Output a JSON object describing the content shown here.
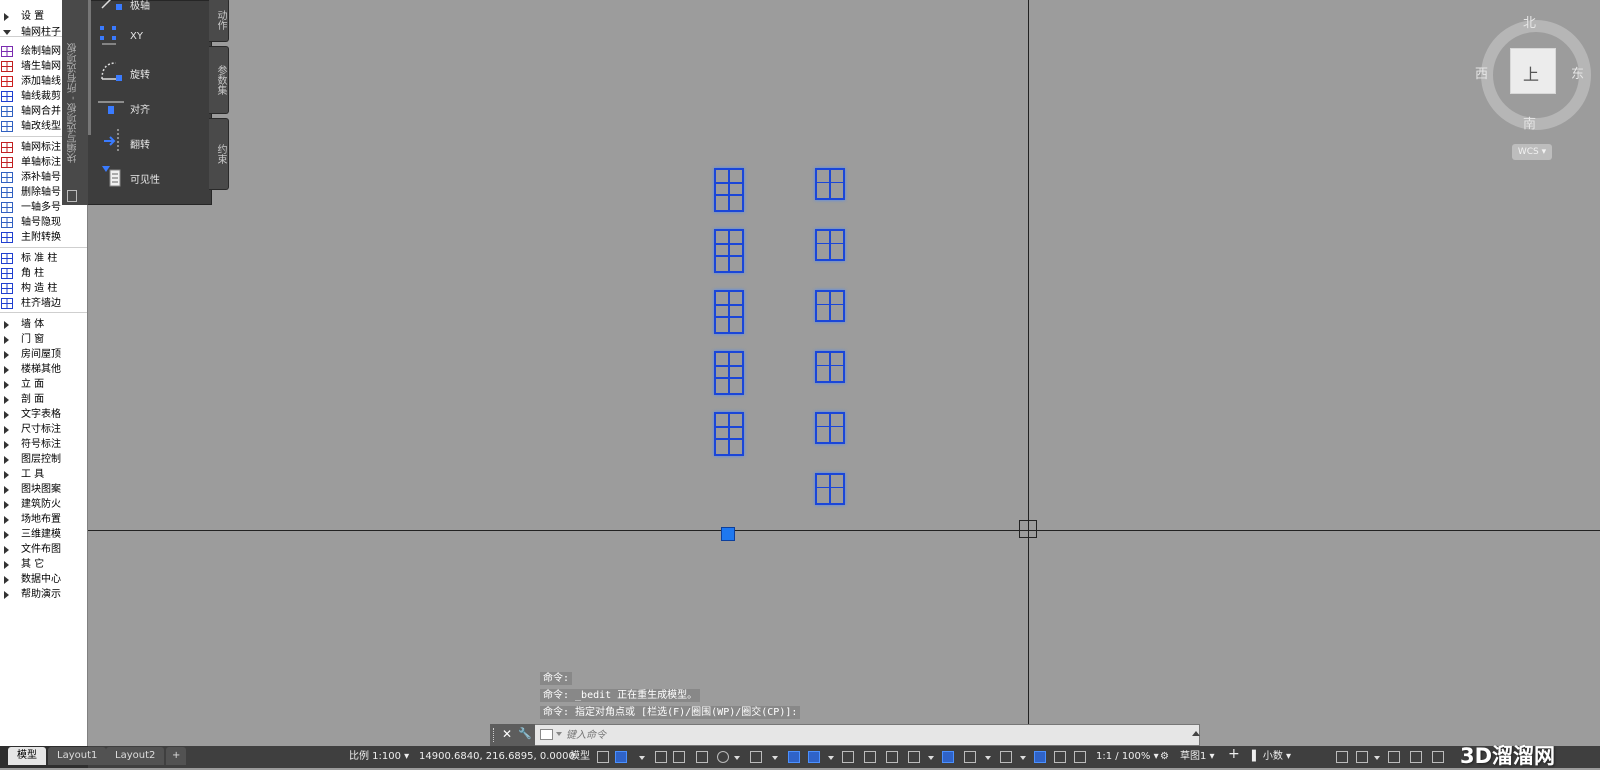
{
  "left_menu": {
    "items": [
      {
        "label": "设    置",
        "icon": "arrow-right",
        "kind": "arrow"
      },
      {
        "label": "轴网柱子",
        "icon": "arrow-down",
        "kind": "arrowd"
      },
      {
        "label": "绘制轴网",
        "icon": "grid-icon"
      },
      {
        "label": "墙生轴网",
        "icon": "wall-grid-icon"
      },
      {
        "label": "添加轴线",
        "icon": "add-axis-icon"
      },
      {
        "label": "轴线裁剪",
        "icon": "trim-axis-icon"
      },
      {
        "label": "轴网合并",
        "icon": "merge-grid-icon"
      },
      {
        "label": "轴改线型",
        "icon": "linetype-icon"
      },
      {
        "label": "轴网标注",
        "icon": "grid-dim-icon"
      },
      {
        "label": "单轴标注",
        "icon": "single-dim-icon"
      },
      {
        "label": "添补轴号",
        "icon": "add-number-icon"
      },
      {
        "label": "删除轴号",
        "icon": "delete-number-icon"
      },
      {
        "label": "一轴多号",
        "icon": "multi-number-icon"
      },
      {
        "label": "轴号隐现",
        "icon": "toggle-number-icon"
      },
      {
        "label": "主附转换",
        "icon": "convert-icon"
      },
      {
        "label": "标 准 柱",
        "icon": "std-column-icon"
      },
      {
        "label": "角    柱",
        "icon": "corner-column-icon"
      },
      {
        "label": "构 造 柱",
        "icon": "struct-column-icon"
      },
      {
        "label": "柱齐墙边",
        "icon": "align-column-icon"
      },
      {
        "label": "墙    体",
        "kind": "arrow"
      },
      {
        "label": "门    窗",
        "kind": "arrow"
      },
      {
        "label": "房间屋顶",
        "kind": "arrow"
      },
      {
        "label": "楼梯其他",
        "kind": "arrow"
      },
      {
        "label": "立    面",
        "kind": "arrow"
      },
      {
        "label": "剖    面",
        "kind": "arrow"
      },
      {
        "label": "文字表格",
        "kind": "arrow"
      },
      {
        "label": "尺寸标注",
        "kind": "arrow"
      },
      {
        "label": "符号标注",
        "kind": "arrow"
      },
      {
        "label": "图层控制",
        "kind": "arrow"
      },
      {
        "label": "工    具",
        "kind": "arrow"
      },
      {
        "label": "图块图案",
        "kind": "arrow"
      },
      {
        "label": "建筑防火",
        "kind": "arrow"
      },
      {
        "label": "场地布置",
        "kind": "arrow"
      },
      {
        "label": "三维建模",
        "kind": "arrow"
      },
      {
        "label": "文件布图",
        "kind": "arrow"
      },
      {
        "label": "其    它",
        "kind": "arrow"
      },
      {
        "label": "数据中心",
        "kind": "arrow"
      },
      {
        "label": "帮助演示",
        "kind": "arrow"
      }
    ]
  },
  "palette": {
    "title": "块编写选项板 - 所有选项板",
    "items": [
      {
        "label": "极轴",
        "icon": "polar-icon"
      },
      {
        "label": "XY",
        "icon": "xy-icon"
      },
      {
        "label": "旋转",
        "icon": "rotate-icon"
      },
      {
        "label": "对齐",
        "icon": "align-icon"
      },
      {
        "label": "翻转",
        "icon": "flip-icon"
      },
      {
        "label": "可见性",
        "icon": "visibility-icon"
      }
    ],
    "tabs": [
      "动作",
      "参数集",
      "约束"
    ]
  },
  "viewcube": {
    "north": "北",
    "south": "南",
    "east": "东",
    "west": "西",
    "face": "上",
    "wcs": "WCS"
  },
  "command": {
    "history": [
      "命令:",
      "命令: _bedit 正在重生成模型。",
      "命令: 指定对角点或 [栏选(F)/圈围(WP)/圈交(CP)]:"
    ],
    "placeholder": "键入命令"
  },
  "layout_tabs": [
    "模型",
    "Layout1",
    "Layout2",
    "+"
  ],
  "status": {
    "scale": "比例 1:100",
    "coords": "14900.6840, 216.6895, 0.0000",
    "model": "模型",
    "annotation_scale": "1:1 / 100%",
    "workspace": "草图",
    "units": "小数"
  },
  "watermark": "3D溜溜网",
  "colors": {
    "canvas": "#9c9c9c",
    "selection_blue": "#1a46d8",
    "palette_bg": "#3d3d3d"
  }
}
